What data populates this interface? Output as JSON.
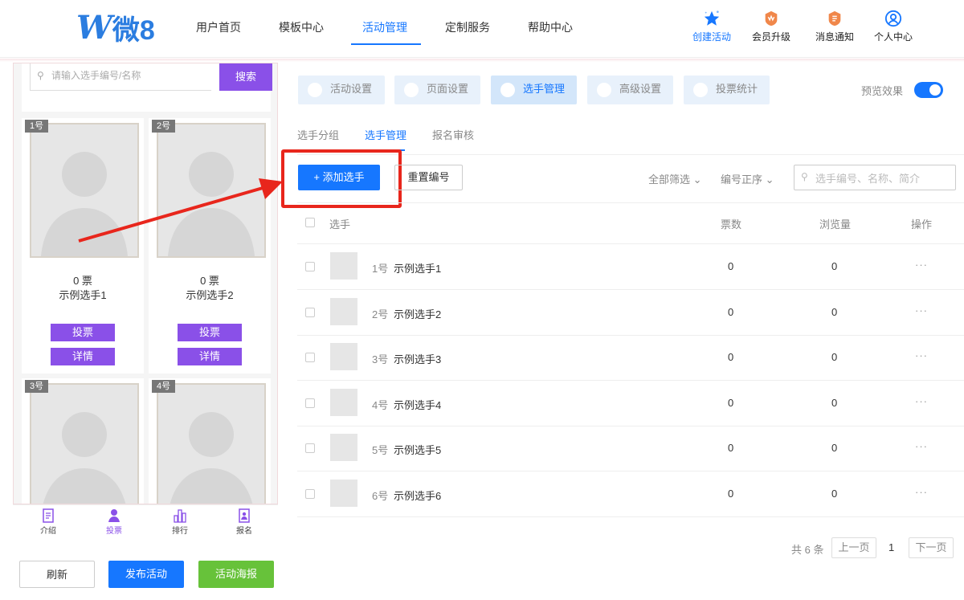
{
  "brand": {
    "logo_letter": "W",
    "logo_text": "微8",
    "color": "#2b7de0"
  },
  "nav": {
    "items": [
      "用户首页",
      "模板中心",
      "活动管理",
      "定制服务",
      "帮助中心"
    ],
    "active_index": 2
  },
  "header_actions": [
    {
      "label": "创建活动",
      "icon": "star-icon"
    },
    {
      "label": "会员升级",
      "icon": "vip-badge-icon"
    },
    {
      "label": "消息通知",
      "icon": "bell-badge-icon"
    },
    {
      "label": "个人中心",
      "icon": "user-circle-icon"
    }
  ],
  "preview": {
    "search_placeholder": "请输入选手编号/名称",
    "search_button": "搜索",
    "cards": [
      {
        "number": "1号",
        "votes": "0 票",
        "name": "示例选手1",
        "vote_btn": "投票",
        "detail_btn": "详情"
      },
      {
        "number": "2号",
        "votes": "0 票",
        "name": "示例选手2",
        "vote_btn": "投票",
        "detail_btn": "详情"
      },
      {
        "number": "3号"
      },
      {
        "number": "4号"
      }
    ],
    "tabs": [
      {
        "label": "介绍",
        "icon": "document-icon"
      },
      {
        "label": "投票",
        "icon": "person-icon"
      },
      {
        "label": "排行",
        "icon": "bar-chart-icon"
      },
      {
        "label": "报名",
        "icon": "signup-icon"
      }
    ],
    "active_tab": 1
  },
  "bottom_buttons": {
    "refresh": "刷新",
    "publish": "发布活动",
    "poster": "活动海报"
  },
  "settings_tabs": [
    "活动设置",
    "页面设置",
    "选手管理",
    "高级设置",
    "投票统计"
  ],
  "settings_active": 2,
  "preview_toggle": {
    "label": "预览效果",
    "on": true
  },
  "sub_tabs": [
    "选手分组",
    "选手管理",
    "报名审核"
  ],
  "sub_active": 1,
  "toolbar": {
    "add": "+ 添加选手",
    "reset": "重置编号",
    "filter_all": "全部筛选",
    "sort": "编号正序",
    "search_placeholder": "选手编号、名称、简介"
  },
  "table": {
    "headers": {
      "player": "选手",
      "votes": "票数",
      "views": "浏览量",
      "ops": "操作"
    },
    "rows": [
      {
        "num": "1号",
        "name": "示例选手1",
        "votes": "0",
        "views": "0"
      },
      {
        "num": "2号",
        "name": "示例选手2",
        "votes": "0",
        "views": "0"
      },
      {
        "num": "3号",
        "name": "示例选手3",
        "votes": "0",
        "views": "0"
      },
      {
        "num": "4号",
        "name": "示例选手4",
        "votes": "0",
        "views": "0"
      },
      {
        "num": "5号",
        "name": "示例选手5",
        "votes": "0",
        "views": "0"
      },
      {
        "num": "6号",
        "name": "示例选手6",
        "votes": "0",
        "views": "0"
      }
    ],
    "more": "···"
  },
  "pager": {
    "total": "共 6 条",
    "prev": "上一页",
    "current": "1",
    "next": "下一页"
  },
  "colors": {
    "primary": "#1677ff",
    "purple": "#8a50e8",
    "green": "#67c23a",
    "highlight": "#e8261c"
  }
}
